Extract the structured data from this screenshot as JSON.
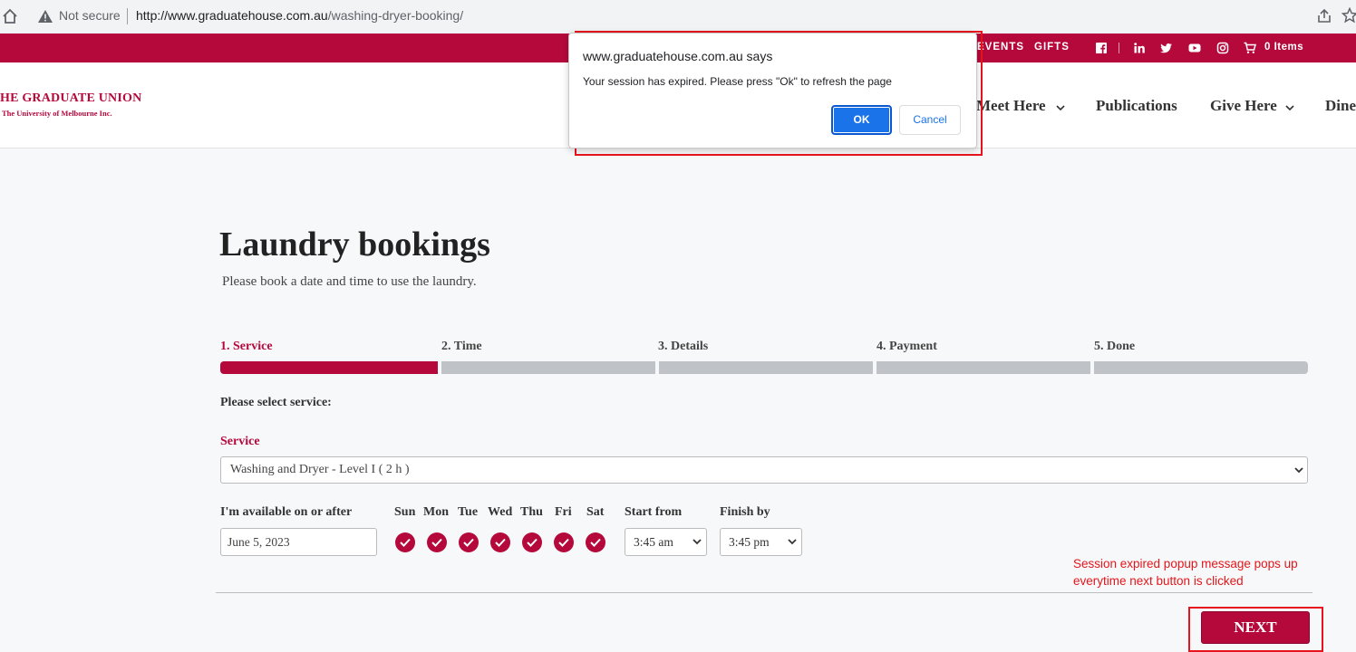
{
  "browser": {
    "security_label": "Not secure",
    "url_host": "http://www.graduatehouse.com.au",
    "url_path": "/washing-dryer-booking/"
  },
  "topbar": {
    "links": [
      "EVENTS",
      "GIFTS"
    ],
    "social_icons": [
      "facebook-icon",
      "linkedin-icon",
      "twitter-icon",
      "youtube-icon",
      "instagram-icon"
    ],
    "cart_label": "0 Items"
  },
  "header": {
    "logo_line1": "HE GRADUATE UNION",
    "logo_line2": "The University of Melbourne Inc.",
    "nav": [
      "Meet Here",
      "Publications",
      "Give Here",
      "Dine"
    ]
  },
  "main": {
    "title": "Laundry bookings",
    "subtitle": "Please book a date and time to use the laundry.",
    "steps": [
      "1. Service",
      "2. Time",
      "3. Details",
      "4. Payment",
      "5. Done"
    ],
    "active_step": 1,
    "select_prompt": "Please select service:",
    "service_label": "Service",
    "service_value": "Washing and Dryer - Level I ( 2 h )",
    "available_label": "I'm available on or after",
    "date_value": "June 5, 2023",
    "days": [
      "Sun",
      "Mon",
      "Tue",
      "Wed",
      "Thu",
      "Fri",
      "Sat"
    ],
    "start_label": "Start from",
    "start_value": "3:45 am",
    "finish_label": "Finish by",
    "finish_value": "3:45 pm",
    "next_label": "NEXT"
  },
  "annotation": {
    "note_line1": "Session expired popup message pops up",
    "note_line2": "everytime next button is clicked"
  },
  "dialog": {
    "title": "www.graduatehouse.com.au says",
    "message": "Your session has expired. Please press \"Ok\" to refresh the page",
    "ok_label": "OK",
    "cancel_label": "Cancel"
  },
  "colors": {
    "brand": "#b5093c",
    "annotation": "#e8141d",
    "dialog_primary": "#1a73e8"
  }
}
